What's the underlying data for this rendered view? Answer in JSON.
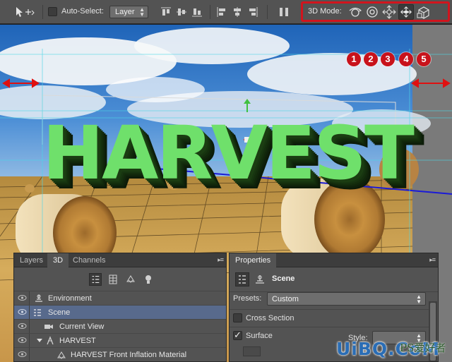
{
  "toolbar": {
    "auto_select_label": "Auto-Select:",
    "layer_select_value": "Layer",
    "mode3d_label": "3D Mode:",
    "mode3d_tools": [
      "rotate-3d-icon",
      "roll-3d-icon",
      "drag-3d-icon",
      "slide-3d-icon",
      "scale-3d-icon"
    ],
    "active_mode_tool": "slide-3d-icon"
  },
  "annotations": {
    "badges": [
      "1",
      "2",
      "3",
      "4",
      "5"
    ],
    "badge_color": "#c8121b",
    "highlight_color": "#d2141d"
  },
  "canvas": {
    "title_text": "HARVEST",
    "text_color": "#6fe06b"
  },
  "panel_3d": {
    "tabs": [
      "Layers",
      "3D",
      "Channels"
    ],
    "active_tab": "3D",
    "filter_icons": [
      "scene-filter-icon",
      "mesh-filter-icon",
      "material-filter-icon",
      "light-filter-icon"
    ],
    "tree": [
      {
        "label": "Environment",
        "icon": "environment-icon"
      },
      {
        "label": "Scene",
        "icon": "scene-icon",
        "selected": true
      },
      {
        "label": "Current View",
        "icon": "camera-icon"
      },
      {
        "label": "HARVEST",
        "icon": "mesh-icon",
        "expanded": true
      },
      {
        "label": "HARVEST Front Inflation Material",
        "icon": "material-icon"
      }
    ]
  },
  "properties": {
    "tab": "Properties",
    "title": "Scene",
    "presets_label": "Presets:",
    "presets_value": "Custom",
    "cross_section_label": "Cross Section",
    "cross_section_checked": false,
    "surface_label": "Surface",
    "surface_checked": true,
    "style_label": "Style:"
  },
  "watermark": {
    "text": "UiBQ.CoM",
    "cn": "PS爱好者"
  }
}
